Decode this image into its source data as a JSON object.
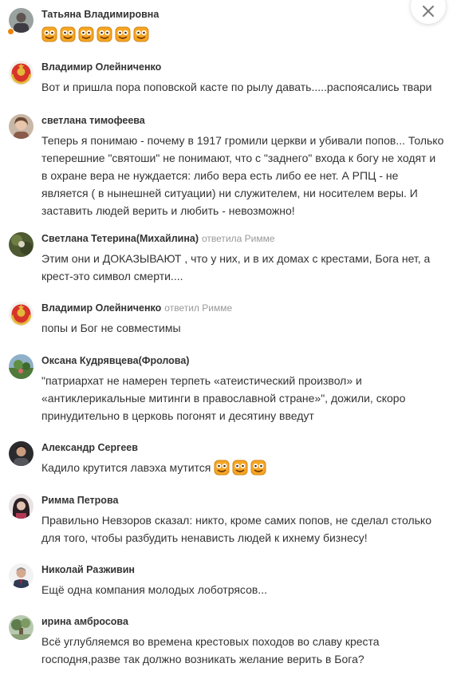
{
  "close_icon": "close-icon",
  "comments": [
    {
      "author": "Татьяна Владимировна",
      "reply_to": "",
      "text": ""
    },
    {
      "author": "Владимир Олейниченко",
      "reply_to": "",
      "text": "Вот и пришла пора поповской касте по рылу давать.....распоясались твари"
    },
    {
      "author": "светлана тимофеева",
      "reply_to": "",
      "text": "Теперь я понимаю - почему в 1917 громили церкви и убивали попов... Только теперешние \"святоши\" не понимают, что с \"заднего\" входа к богу не ходят и в охране вера не нуждается: либо вера есть либо ее нет. А РПЦ - не является ( в нынешней ситуации) ни служителем, ни носителем веры. И заставить людей верить и любить - невозможно!"
    },
    {
      "author": "Светлана Тетерина(Михайлина)",
      "reply_to": "ответила Римме",
      "text": "Этим они и ДОКАЗЫВАЮТ , что у них, и в их домах с крестами, Бога нет, а крест-это символ смерти...."
    },
    {
      "author": "Владимир Олейниченко",
      "reply_to": "ответил Римме",
      "text": "попы и Бог не совместимы"
    },
    {
      "author": "Оксана Кудрявцева(Фролова)",
      "reply_to": "",
      "text": "\"патриархат не намерен терпеть «атеистический произвол» и «антиклерикальные митинги в православной стране»\", дожили, скоро принудительно в церковь погонят и десятину введут"
    },
    {
      "author": "Александр Сергеев",
      "reply_to": "",
      "text": "Кадило крутится лавэха мутится"
    },
    {
      "author": "Римма Петрова",
      "reply_to": "",
      "text": "Правильно Невзоров сказал: никто, кроме самих попов, не сделал столько для того, чтобы разбудить ненависть людей к ихнему бизнесу!"
    },
    {
      "author": "Николай Разживин",
      "reply_to": "",
      "text": "Ещё одна компания молодых лоботрясов..."
    },
    {
      "author": "ирина амбросова",
      "reply_to": "",
      "text": "Всё углубляемся во времена крестовых походов во славу креста господня,разве так должно возникать желание верить в Бога?"
    }
  ],
  "colors": {
    "accent": "#ee8208",
    "author": "#333333",
    "meta": "#999999"
  }
}
